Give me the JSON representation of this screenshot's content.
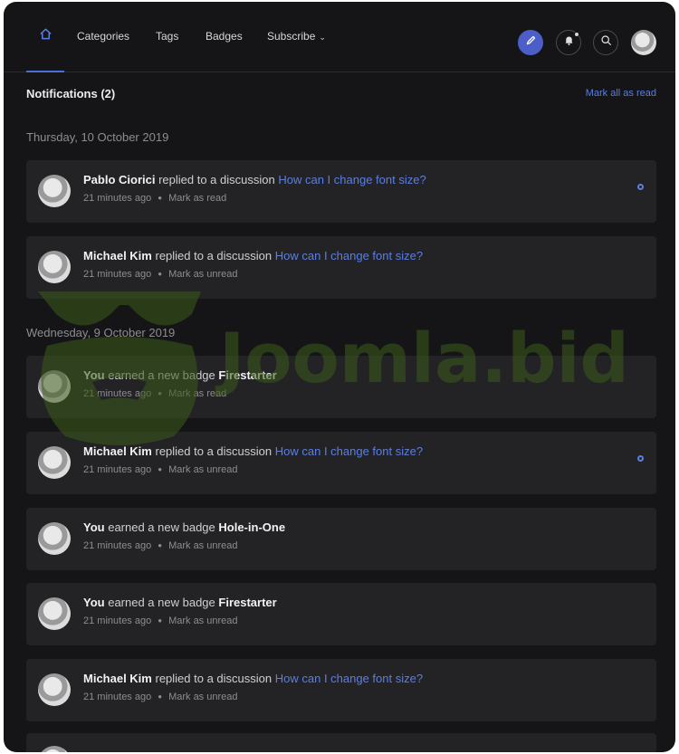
{
  "nav": {
    "items": [
      {
        "label": "Categories"
      },
      {
        "label": "Tags"
      },
      {
        "label": "Badges"
      },
      {
        "label": "Subscribe"
      }
    ]
  },
  "header": {
    "title": "Notifications (2)",
    "mark_all": "Mark all as read"
  },
  "groups": [
    {
      "date": "Thursday, 10 October 2019"
    },
    {
      "date": "Wednesday, 9 October 2019"
    }
  ],
  "notifications": [
    {
      "actor": "Pablo Ciorici",
      "action": "replied to a discussion",
      "target": "How can I change font size?",
      "time": "21 minutes ago",
      "mark": "Mark as read",
      "unread": true
    },
    {
      "actor": "Michael Kim",
      "action": "replied to a discussion",
      "target": "How can I change font size?",
      "time": "21 minutes ago",
      "mark": "Mark as unread",
      "unread": false
    },
    {
      "actor": "You",
      "action": "earned a new badge",
      "target": "Firestarter",
      "time": "21 minutes ago",
      "mark": "Mark as read",
      "unread": false
    },
    {
      "actor": "Michael Kim",
      "action": "replied to a discussion",
      "target": "How can I change font size?",
      "time": "21 minutes ago",
      "mark": "Mark as unread",
      "unread": true
    },
    {
      "actor": "You",
      "action": "earned a new badge",
      "target": "Hole-in-One",
      "time": "21 minutes ago",
      "mark": "Mark as unread",
      "unread": false
    },
    {
      "actor": "You",
      "action": "earned a new badge",
      "target": "Firestarter",
      "time": "21 minutes ago",
      "mark": "Mark as unread",
      "unread": false
    },
    {
      "actor": "Michael Kim",
      "action": "replied to a discussion",
      "target": "How can I change font size?",
      "time": "21 minutes ago",
      "mark": "Mark as unread",
      "unread": false
    }
  ],
  "watermark": {
    "text": "Joomla.bid"
  },
  "colors": {
    "background": "#151517",
    "card": "#232326",
    "accent": "#5b7ee0"
  },
  "icons": [
    "home-icon",
    "pencil-icon",
    "bell-icon",
    "search-icon",
    "chevron-down-icon"
  ]
}
